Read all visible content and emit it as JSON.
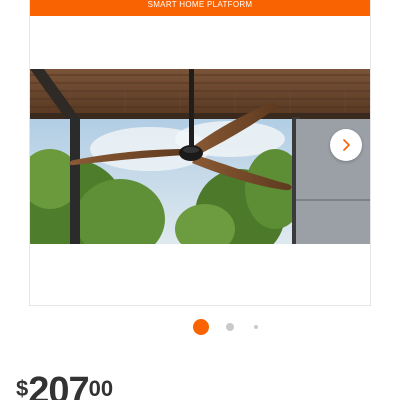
{
  "banner": {
    "text": "SMART HOME PLATFORM",
    "color": "#f96302"
  },
  "gallery": {
    "image_alt": "ceiling fan",
    "next_icon": "chevron-right-icon",
    "dots": {
      "count": 3,
      "active_index": 0,
      "active_color": "#f96302"
    }
  },
  "price": {
    "currency": "$",
    "dollars": "207",
    "cents": "00"
  }
}
